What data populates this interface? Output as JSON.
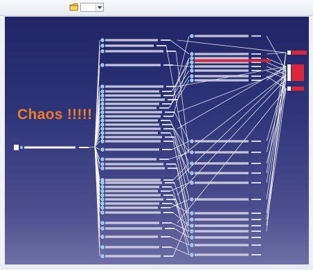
{
  "toolbar": {
    "icons": [
      "folder-icon",
      "dropdown-arrow-icon"
    ],
    "combo_value": ""
  },
  "canvas": {
    "annotation": "Chaos !!!!!",
    "colors": {
      "background_top": "#1f2566",
      "background_bottom": "#6e6fa6",
      "connector": "#ffffff",
      "node_label": "#ffffff",
      "highlight": "#e0243a",
      "annotation": "#f07c23"
    },
    "root_node": {
      "icon": "part-icon"
    },
    "column_a": {
      "node_count": 36,
      "icon": "product-icon"
    },
    "column_b": {
      "node_count": 21,
      "icon": "product-icon"
    },
    "column_c": {
      "node_count": 6,
      "icon": "highlight-node-icon"
    }
  }
}
